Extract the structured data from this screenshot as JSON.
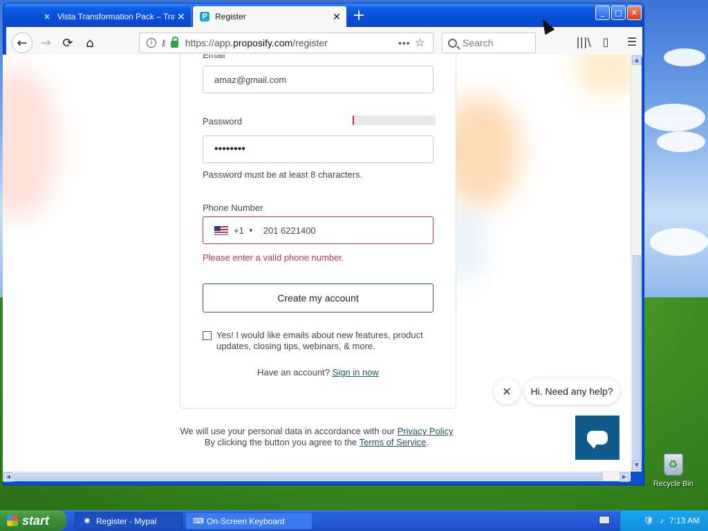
{
  "browser": {
    "tabs": [
      {
        "label": "Vista Transformation Pack – Trans",
        "active": false
      },
      {
        "label": "Register",
        "active": true
      }
    ],
    "url_prefix": "https://app.",
    "url_domain": "proposify.com",
    "url_path": "/register",
    "search_placeholder": "Search"
  },
  "form": {
    "email_label": "Email",
    "email_value": "amaz@gmail.com",
    "password_label": "Password",
    "password_value": "••••••••",
    "password_strength_percent": 2,
    "password_hint": "Password must be at least 8 characters.",
    "phone_label": "Phone Number",
    "phone_country_code": "+1",
    "phone_value": "201 6221400",
    "phone_error": "Please enter a valid phone number.",
    "submit_label": "Create my account",
    "newsletter_label": "Yes! I would like emails about new features, product updates, closing tips, webinars, & more.",
    "signin_prompt": "Have an account?",
    "signin_link": "Sign in now"
  },
  "footer": {
    "privacy_prefix": "We will use your personal data in accordance with our",
    "privacy_link": "Privacy Policy",
    "terms_prefix": "By clicking the button you agree to the",
    "terms_link": "Terms of Service",
    "terms_suffix": "."
  },
  "chat": {
    "bubble_text": "Hi. Need any help?"
  },
  "desktop": {
    "recycle_bin_label": "Recycle Bin"
  },
  "taskbar": {
    "start_label": "start",
    "items": [
      {
        "label": "Register - Mypal"
      },
      {
        "label": "On-Screen Keyboard"
      }
    ],
    "clock": "7:13 AM"
  },
  "colors": {
    "error": "#c0334e",
    "accent_green": "#1f6b4a",
    "chat_blue": "#0e5b8c",
    "link": "#1d4f61"
  }
}
